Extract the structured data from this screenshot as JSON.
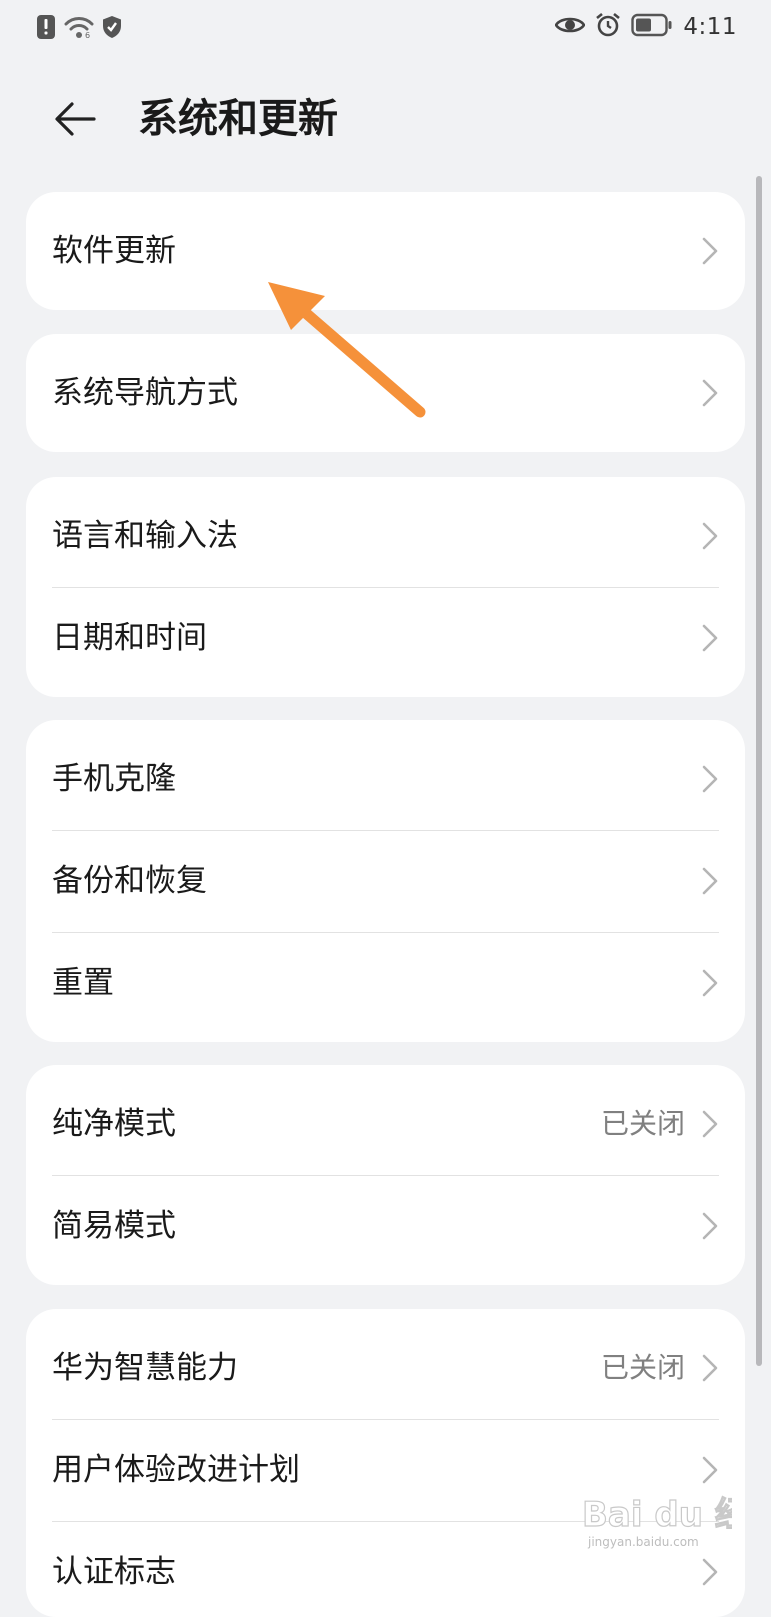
{
  "status_bar": {
    "time": "4:11",
    "icons": [
      "alert-icon",
      "wifi-icon",
      "shield-icon",
      "eye-icon",
      "alarm-icon",
      "battery-icon"
    ]
  },
  "header": {
    "title": "系统和更新",
    "back_icon": "back-arrow-icon"
  },
  "cards": [
    {
      "items": [
        {
          "label": "软件更新"
        }
      ]
    },
    {
      "items": [
        {
          "label": "系统导航方式"
        }
      ]
    },
    {
      "items": [
        {
          "label": "语言和输入法"
        },
        {
          "label": "日期和时间"
        }
      ]
    },
    {
      "items": [
        {
          "label": "手机克隆"
        },
        {
          "label": "备份和恢复"
        },
        {
          "label": "重置"
        }
      ]
    },
    {
      "items": [
        {
          "label": "纯净模式",
          "value": "已关闭"
        },
        {
          "label": "简易模式"
        }
      ]
    },
    {
      "items": [
        {
          "label": "华为智慧能力",
          "value": "已关闭"
        },
        {
          "label": "用户体验改进计划"
        },
        {
          "label": "认证标志"
        }
      ]
    }
  ],
  "annotation": {
    "color": "#f5913a"
  },
  "watermark": {
    "text": "Bai du 经验",
    "subtext": "jingyan.baidu.com"
  }
}
